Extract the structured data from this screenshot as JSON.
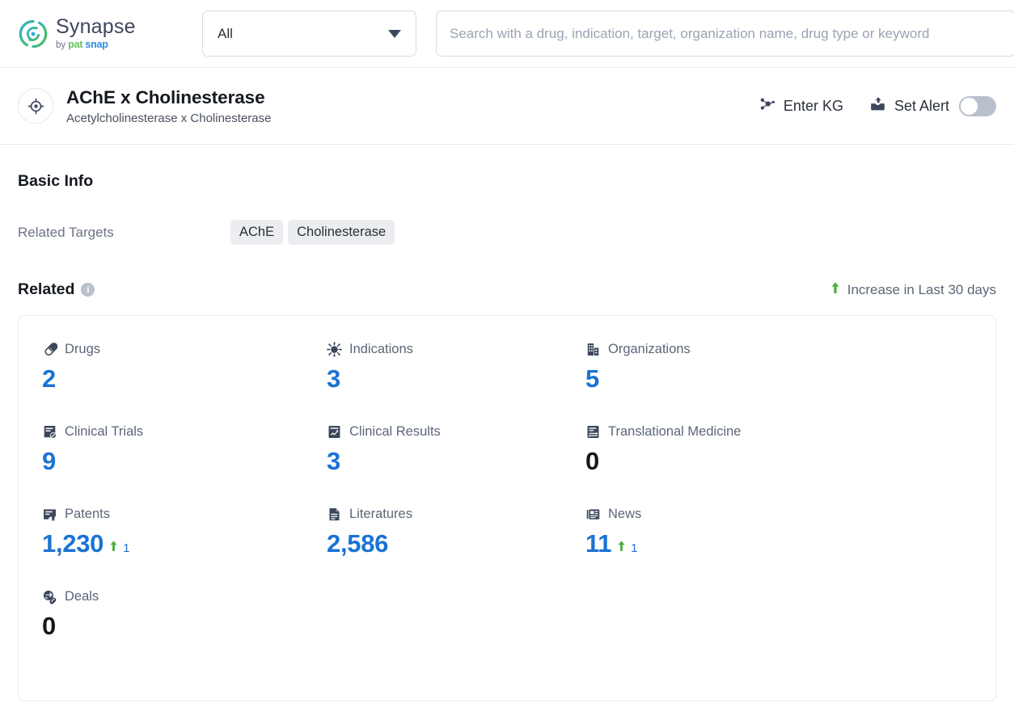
{
  "brand": {
    "name": "Synapse",
    "by": "by",
    "pat": "pat",
    "snap": "snap",
    "logo_icon": "synapse-swirl-logo",
    "colors": {
      "green": "#5fc35a",
      "blue": "#2f8ce0",
      "teal": "#1fb8a6",
      "wordmark": "#3c475c"
    }
  },
  "search": {
    "scope_value": "All",
    "scope_caret_icon": "chevron-down-icon",
    "placeholder": "Search with a drug, indication, target, organization name, drug type or keyword",
    "value": ""
  },
  "entity": {
    "avatar_icon": "target-crosshair-icon",
    "title": "AChE x Cholinesterase",
    "subtitle": "Acetylcholinesterase x Cholinesterase",
    "actions": {
      "enter_kg": {
        "label": "Enter KG",
        "icon": "knowledge-graph-icon"
      },
      "set_alert": {
        "label": "Set Alert",
        "icon": "alert-envelope-icon",
        "toggle_on": false
      }
    }
  },
  "basic_info": {
    "title": "Basic Info",
    "related_targets_label": "Related Targets",
    "related_targets": [
      "AChE",
      "Cholinesterase"
    ]
  },
  "related": {
    "title": "Related",
    "info_icon": "info-icon",
    "info_glyph": "i",
    "legend": {
      "arrow_icon": "arrow-up-icon",
      "text": "Increase in Last 30 days",
      "arrow_color": "#4caf3f"
    },
    "stats": [
      {
        "label": "Drugs",
        "icon": "pill-capsule-icon",
        "value": "2",
        "zero": false,
        "delta": null
      },
      {
        "label": "Indications",
        "icon": "virus-icon",
        "value": "3",
        "zero": false,
        "delta": null
      },
      {
        "label": "Organizations",
        "icon": "building-icon",
        "value": "5",
        "zero": false,
        "delta": null
      },
      {
        "label": "Clinical Trials",
        "icon": "clinical-trial-document-icon",
        "value": "9",
        "zero": false,
        "delta": null
      },
      {
        "label": "Clinical Results",
        "icon": "clinical-results-chart-icon",
        "value": "3",
        "zero": false,
        "delta": null
      },
      {
        "label": "Translational Medicine",
        "icon": "translational-medicine-icon",
        "value": "0",
        "zero": true,
        "delta": null
      },
      {
        "label": "Patents",
        "icon": "patent-certificate-icon",
        "value": "1,230",
        "zero": false,
        "delta": "1"
      },
      {
        "label": "Literatures",
        "icon": "literature-document-icon",
        "value": "2,586",
        "zero": false,
        "delta": null
      },
      {
        "label": "News",
        "icon": "news-paper-icon",
        "value": "11",
        "zero": false,
        "delta": "1"
      },
      {
        "label": "Deals",
        "icon": "deals-exchange-icon",
        "value": "0",
        "zero": true,
        "delta": null
      }
    ]
  }
}
